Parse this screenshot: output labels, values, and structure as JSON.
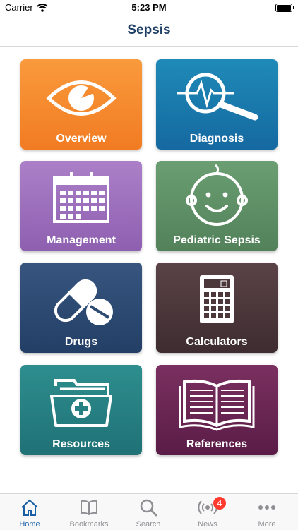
{
  "status_bar": {
    "carrier": "Carrier",
    "time": "5:23 PM",
    "battery_level": 1.0
  },
  "nav": {
    "title": "Sepsis"
  },
  "tiles": [
    {
      "label": "Overview",
      "icon": "eye-icon",
      "color": "#f58a2e"
    },
    {
      "label": "Diagnosis",
      "icon": "heartbeat-magnifier-icon",
      "color": "#1a78ad"
    },
    {
      "label": "Management",
      "icon": "calendar-icon",
      "color": "#9c6fbd"
    },
    {
      "label": "Pediatric Sepsis",
      "icon": "baby-face-icon",
      "color": "#5e8f66"
    },
    {
      "label": "Drugs",
      "icon": "pills-icon",
      "color": "#2d4a73"
    },
    {
      "label": "Calculators",
      "icon": "calculator-icon",
      "color": "#4c383b"
    },
    {
      "label": "Resources",
      "icon": "medical-folder-icon",
      "color": "#267f82"
    },
    {
      "label": "References",
      "icon": "open-book-icon",
      "color": "#6a2653"
    }
  ],
  "tab_bar": {
    "tabs": [
      {
        "label": "Home",
        "icon": "home-icon",
        "active": true
      },
      {
        "label": "Bookmarks",
        "icon": "book-icon",
        "active": false
      },
      {
        "label": "Search",
        "icon": "search-icon",
        "active": false
      },
      {
        "label": "News",
        "icon": "broadcast-icon",
        "active": false,
        "badge": "4"
      },
      {
        "label": "More",
        "icon": "ellipsis-icon",
        "active": false
      }
    ],
    "active_color": "#1a5fa5",
    "inactive_color": "#8e8e93"
  }
}
